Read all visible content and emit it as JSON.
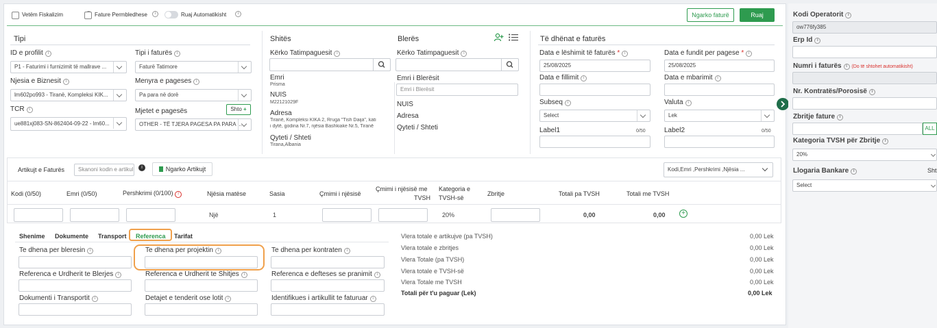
{
  "top": {
    "cb_fiskal": "Vetëm Fiskalizim",
    "cb_permbledhese": "Fature Permbledhese",
    "toggle_ruaj": "Ruaj Automatikisht",
    "btn_ngarko": "Ngarko faturë",
    "btn_ruaj": "Ruaj"
  },
  "tipi": {
    "title": "Tipi",
    "profil_label": "ID e profilit",
    "profil_value": "P1 - Faturimi i furnizimit të mallrave ...",
    "tipi_fatures_label": "Tipi i faturës",
    "tipi_fatures_value": "Faturë Tatimore",
    "njesia_label": "Njesia e Biznesit",
    "njesia_value": "lm602po993 - Tiranë, Kompleksi KIK...",
    "menyra_label": "Menyra e pageses",
    "menyra_value": "Pa para në dorë",
    "tcr_label": "TCR",
    "tcr_value": "ue881xj083-SN-862404-09-22 - lm60...",
    "mjetet_label": "Mjetet e pagesës",
    "shto_label": "Shto",
    "mjetet_value": "OTHER - TË TJERA PAGESA PA PARA ..."
  },
  "shites": {
    "title": "Shitës",
    "kerko_label": "Kërko Tatimpaguesit",
    "emri_label": "Emri",
    "emri_value": "Prisma",
    "nuis_label": "NUIS",
    "nuis_value": "M22121029F",
    "adresa_label": "Adresa",
    "adresa_line1": "Tiranë, Kompleksi KIKA 2, Rruga \"Tish Daija\", kati",
    "adresa_line2": "i dytë, godina Nr.7, njësia Bashkiake Nr.5, Tiranë",
    "qyteti_label": "Qyteti / Shteti",
    "qyteti_value": "Tirana,Albania"
  },
  "bleres": {
    "title": "Blerës",
    "kerko_label": "Kërko Tatimpaguesit",
    "emri_label": "Emri i Blerësit",
    "emri_placeholder": "Emri i Blerësit",
    "nuis_label": "NUIS",
    "adresa_label": "Adresa",
    "qyteti_label": "Qyteti / Shteti"
  },
  "dhenat": {
    "title": "Të dhënat e faturës",
    "data_leshimit_label": "Data e lëshimit të faturës",
    "data_leshimit_value": "25/08/2025",
    "data_fundit_label": "Data e fundit per pagese",
    "data_fundit_value": "25/08/2025",
    "data_fillimit_label": "Data e fillimit",
    "data_mbarimit_label": "Data e mbarimit",
    "subseq_label": "Subseq",
    "subseq_value": "Select",
    "valuta_label": "Valuta",
    "valuta_value": "Lek",
    "label1": "Label1",
    "label1_count": "0/50",
    "label2": "Label2",
    "label2_count": "0/50"
  },
  "artikujt": {
    "title": "Artikujt e Faturës",
    "scan_placeholder": "Skanoni kodin e artikullit",
    "ngarko_label": "Ngarko Artikujt",
    "search_select": "Kodi,Emri ,Pershkrimi ,Njësia ...",
    "headers": {
      "kodi": "Kodi (0/50)",
      "emri": "Emri  (0/50)",
      "pershkrimi": "Pershkrimi  (0/100)",
      "njesia": "Njësia matëse",
      "sasia": "Sasia",
      "cmimi": "Çmimi i njësisë",
      "cmimi_tvsh_1": "Çmimi i njësisë  me",
      "cmimi_tvsh_2": "TVSH",
      "kategoria_1": "Kategoria e",
      "kategoria_2": "TVSH-së",
      "zbritje": "Zbritje",
      "pa_tvsh": "Totali pa TVSH",
      "me_tvsh": "Totali me TVSH"
    },
    "row": {
      "njesia": "Një",
      "sasia": "1",
      "kategoria": "20%",
      "pa_tvsh": "0,00",
      "me_tvsh": "0,00"
    }
  },
  "tabs": [
    "Shenime",
    "Dokumente",
    "Transport",
    "Referenca",
    "Tarifat"
  ],
  "referenca": {
    "f1": "Te dhena per bleresin",
    "f2": "Te dhena per projektin",
    "f3": "Te dhena per kontraten",
    "f4": "Referenca e Urdherit te Blerjes",
    "f5": "Referenca e Urdherit te Shitjes",
    "f6": "Referenca e defteses se pranimit",
    "f7": "Dokumenti i Transportit",
    "f8": "Detajet e tenderit ose lotit",
    "f9": "Identifikues i artikullit te faturuar"
  },
  "totals": [
    {
      "label": "Vlera totale e artikujve (pa TVSH)",
      "value": "0,00 Lek"
    },
    {
      "label": "Vlera totale e zbritjes",
      "value": "0,00 Lek"
    },
    {
      "label": "Vlera Totale (pa TVSH)",
      "value": "0,00 Lek"
    },
    {
      "label": "Vlera totale e TVSH-së",
      "value": "0,00 Lek"
    },
    {
      "label": "Vlera Totale me TVSH",
      "value": "0,00 Lek"
    },
    {
      "label": "Totali për t'u paguar (Lek)",
      "value": "0,00 Lek"
    }
  ],
  "side": {
    "kodi_label": "Kodi Operatorit",
    "kodi_value": "ow776fy385",
    "erp_label": "Erp Id",
    "numri_label": "Numri i faturës",
    "numri_note": "(Do të shtohet automatikisht)",
    "kontrates_label": "Nr. Kontratës/Porosisë",
    "zbritje_label": "Zbritje fature",
    "all_label": "ALL",
    "kategoria_label": "Kategoria TVSH për Zbritje",
    "kategoria_value": "20%",
    "llogaria_label": "Llogaria Bankare",
    "llogaria_value": "Select",
    "shtc_label": "Sht"
  },
  "colors": {
    "accent": "#2e9b4f",
    "highlight": "#f0a04b"
  }
}
